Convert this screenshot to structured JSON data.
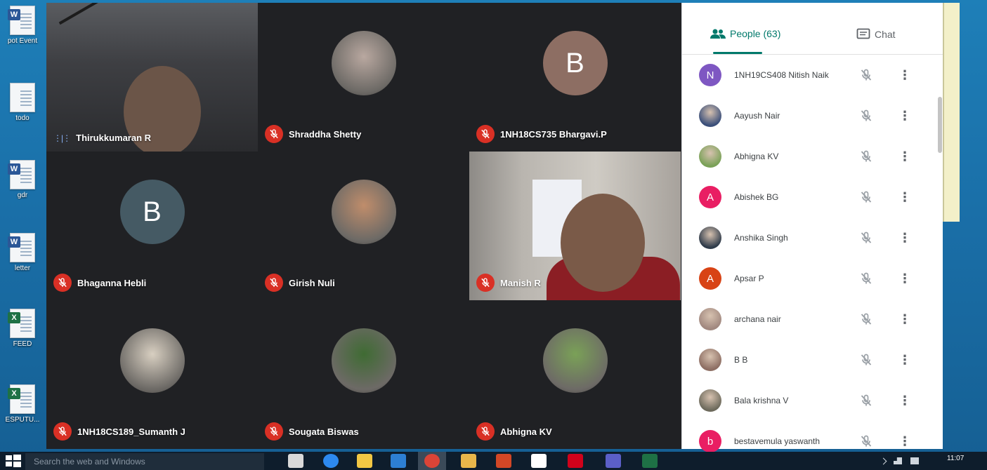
{
  "desktop": {
    "icons": [
      {
        "label": "pot Event\ntemplate_...",
        "type": "W",
        "color": "#2b5797"
      },
      {
        "label": "todo",
        "type": "",
        "color": "#ffffff"
      },
      {
        "label": "gdr",
        "type": "W",
        "color": "#2b5797"
      },
      {
        "label": "letter",
        "type": "W",
        "color": "#2b5797"
      },
      {
        "label": "FEED",
        "type": "X",
        "color": "#1e7145"
      },
      {
        "label": "ESPUTU...",
        "type": "X",
        "color": "#1e7145"
      }
    ]
  },
  "meeting": {
    "participants": [
      {
        "name": "Thirukkumaran R",
        "kind": "video-room",
        "muted": false,
        "speaking": true
      },
      {
        "name": "Shraddha Shetty",
        "kind": "photo",
        "muted": true,
        "photo_color": "#b9a8a0"
      },
      {
        "name": "1NH18CS735 Bhargavi.P",
        "kind": "letter",
        "letter": "B",
        "bg": "#8d6e63",
        "muted": true
      },
      {
        "name": "Bhaganna Hebli",
        "kind": "letter",
        "letter": "B",
        "bg": "#455a64",
        "muted": true
      },
      {
        "name": "Girish Nuli",
        "kind": "photo",
        "muted": true,
        "photo_color": "#c08d6b"
      },
      {
        "name": "Manish R",
        "kind": "video-office",
        "muted": true
      },
      {
        "name": "1NH18CS189_Sumanth J",
        "kind": "photo",
        "muted": true,
        "photo_color": "#d8cfc1"
      },
      {
        "name": "Sougata Biswas",
        "kind": "photo",
        "muted": true,
        "photo_color": "#3f6b33"
      },
      {
        "name": "Abhigna KV",
        "kind": "photo",
        "muted": true,
        "photo_color": "#7aa157"
      }
    ]
  },
  "panel": {
    "people_tab": "People (63)",
    "chat_tab": "Chat",
    "people": [
      {
        "name": "1NH19CS408 Nitish Naik",
        "letter": "N",
        "bg": "#7e57c2"
      },
      {
        "name": "Aayush Nair",
        "letter": "",
        "bg": "#3b4f7a"
      },
      {
        "name": "Abhigna KV",
        "letter": "",
        "bg": "#7aa157"
      },
      {
        "name": "Abishek BG",
        "letter": "A",
        "bg": "#e91e63"
      },
      {
        "name": "Anshika Singh",
        "letter": "",
        "bg": "#2f3b4a"
      },
      {
        "name": "Apsar P",
        "letter": "A",
        "bg": "#d84315"
      },
      {
        "name": "archana nair",
        "letter": "",
        "bg": "#a1887f"
      },
      {
        "name": "B B",
        "letter": "",
        "bg": "#8d6e63"
      },
      {
        "name": "Bala krishna V",
        "letter": "",
        "bg": "#6d6a5c"
      },
      {
        "name": "bestavemula yaswanth",
        "letter": "b",
        "bg": "#e91e63"
      }
    ]
  },
  "taskbar": {
    "search_placeholder": "Search the web and Windows",
    "time": "11:07",
    "apps": [
      {
        "name": "task-view",
        "color": "#d9d9d9"
      },
      {
        "name": "cortana",
        "color": "#2d89ef"
      },
      {
        "name": "file-explorer",
        "color": "#f2c744"
      },
      {
        "name": "edge",
        "color": "#2d7fd3"
      },
      {
        "name": "chrome",
        "color": "#db4437"
      },
      {
        "name": "folder",
        "color": "#e8b64a"
      },
      {
        "name": "powerpoint",
        "color": "#d24726"
      },
      {
        "name": "store",
        "color": "#ffffff"
      },
      {
        "name": "acrobat",
        "color": "#d0021b"
      },
      {
        "name": "teams",
        "color": "#5b5fc7"
      },
      {
        "name": "excel",
        "color": "#1e7145"
      }
    ]
  }
}
